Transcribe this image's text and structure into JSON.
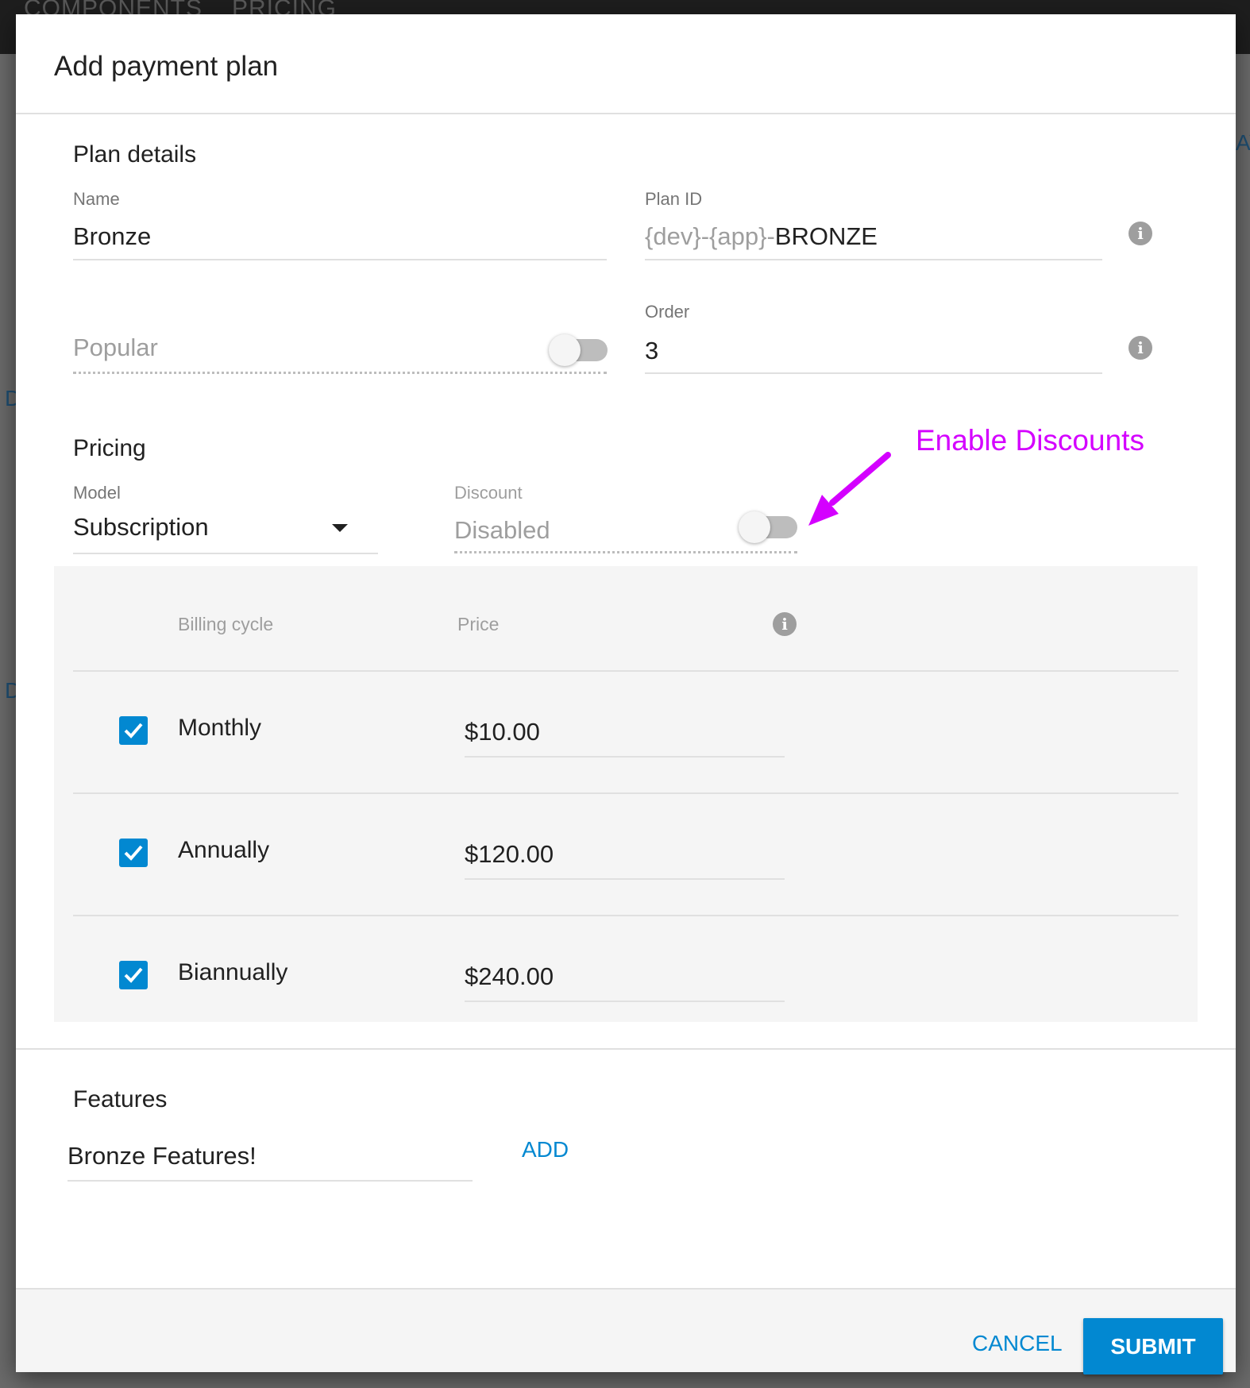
{
  "background": {
    "nav": [
      "COMPONENTS",
      "PRICING"
    ],
    "side_letters": [
      "D",
      "D"
    ],
    "right_letters": "AY"
  },
  "dialog": {
    "title": "Add payment plan",
    "plan_details": {
      "heading": "Plan details",
      "name": {
        "label": "Name",
        "value": "Bronze"
      },
      "plan_id": {
        "label": "Plan ID",
        "prefix": "{dev}-{app}-",
        "value": "BRONZE"
      },
      "popular": {
        "label": "Popular",
        "enabled": false
      },
      "order": {
        "label": "Order",
        "value": "3"
      }
    },
    "pricing": {
      "heading": "Pricing",
      "model": {
        "label": "Model",
        "value": "Subscription"
      },
      "discount": {
        "label": "Discount",
        "value": "Disabled",
        "enabled": false
      },
      "table": {
        "headers": {
          "cycle": "Billing cycle",
          "price": "Price"
        },
        "rows": [
          {
            "checked": true,
            "cycle": "Monthly",
            "price": "$10.00"
          },
          {
            "checked": true,
            "cycle": "Annually",
            "price": "$120.00"
          },
          {
            "checked": true,
            "cycle": "Biannually",
            "price": "$240.00"
          }
        ]
      }
    },
    "features": {
      "heading": "Features",
      "input_value": "Bronze Features!",
      "add_label": "ADD"
    },
    "footer": {
      "cancel_label": "CANCEL",
      "submit_label": "SUBMIT"
    }
  },
  "annotation": {
    "text": "Enable Discounts",
    "color": "#d400ff"
  },
  "colors": {
    "accent": "#0288d1"
  }
}
